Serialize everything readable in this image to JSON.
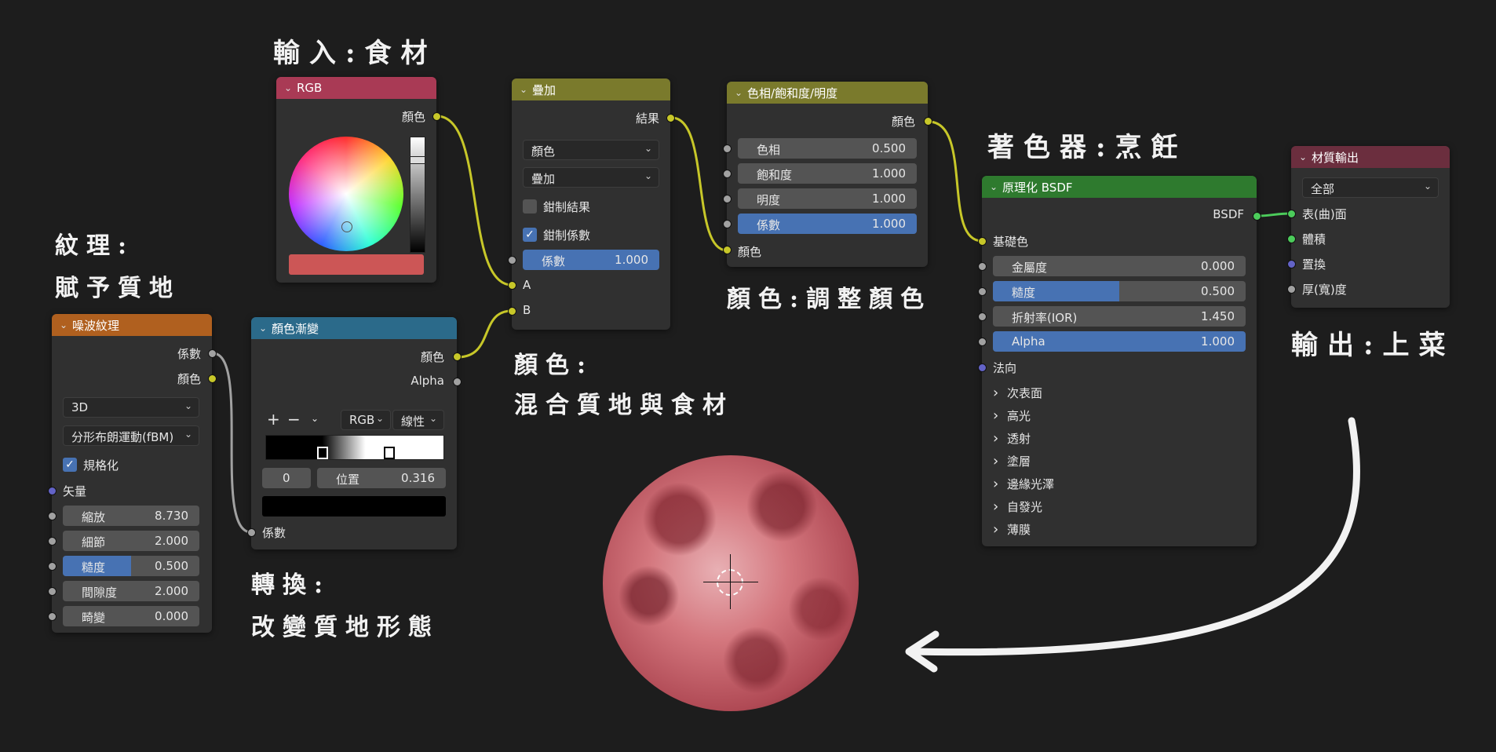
{
  "annotations": {
    "input": "輸入:食材",
    "texture_title": "紋理:",
    "texture_sub": "賦予質地",
    "mix_title": "顏色:",
    "mix_sub": "混合質地與食材",
    "convert_title": "轉換:",
    "convert_sub": "改變質地形態",
    "color_adjust": "顏色:調整顏色",
    "shader": "著色器:烹飪",
    "output": "輸出:上菜"
  },
  "rgb_node": {
    "title": "RGB",
    "color_output": "顏色",
    "swatch_color": "#cc5656",
    "header_color": "#a93a55"
  },
  "mix_node": {
    "title": "疊加",
    "result": "結果",
    "dd1": "顏色",
    "dd2": "疊加",
    "clamp_result": "鉗制結果",
    "clamp_factor": "鉗制係數",
    "factor_label": "係數",
    "factor_value": "1.000",
    "in_a": "A",
    "in_b": "B",
    "header_color": "#7a7a2c"
  },
  "hsv_node": {
    "title": "色相/飽和度/明度",
    "out_color": "顏色",
    "hue_label": "色相",
    "hue_value": "0.500",
    "sat_label": "飽和度",
    "sat_value": "1.000",
    "val_label": "明度",
    "val_value": "1.000",
    "fac_label": "係數",
    "fac_value": "1.000",
    "in_color": "顏色"
  },
  "noise_node": {
    "title": "噪波紋理",
    "out_fac": "係數",
    "out_color": "顏色",
    "dim": "3D",
    "type": "分形布朗運動(fBM)",
    "normalize": "規格化",
    "vector": "矢量",
    "scale_label": "縮放",
    "scale_value": "8.730",
    "detail_label": "細節",
    "detail_value": "2.000",
    "rough_label": "糙度",
    "rough_value": "0.500",
    "lacun_label": "間隙度",
    "lacun_value": "2.000",
    "distort_label": "畸變",
    "distort_value": "0.000",
    "header_color": "#b0601f"
  },
  "ramp_node": {
    "title": "顏色漸變",
    "out_color": "顏色",
    "out_alpha": "Alpha",
    "plus": "+",
    "minus": "−",
    "mode": "RGB",
    "interp": "線性",
    "index": "0",
    "pos_label": "位置",
    "pos_value": "0.316",
    "in_fac": "係數",
    "header_color": "#2b6a8a"
  },
  "bsdf_node": {
    "title": "原理化 BSDF",
    "out_bsdf": "BSDF",
    "base_color": "基礎色",
    "metal_label": "金屬度",
    "metal_value": "0.000",
    "rough_label": "糙度",
    "rough_value": "0.500",
    "ior_label": "折射率(IOR)",
    "ior_value": "1.450",
    "alpha_label": "Alpha",
    "alpha_value": "1.000",
    "normal": "法向",
    "panels": [
      "次表面",
      "高光",
      "透射",
      "塗層",
      "邊緣光澤",
      "自發光",
      "薄膜"
    ],
    "header_color": "#2e7a2e"
  },
  "output_node": {
    "title": "材質輸出",
    "target": "全部",
    "surface": "表(曲)面",
    "volume": "體積",
    "displace": "置換",
    "thickness": "厚(寬)度",
    "header_color": "#6b2e3e"
  }
}
